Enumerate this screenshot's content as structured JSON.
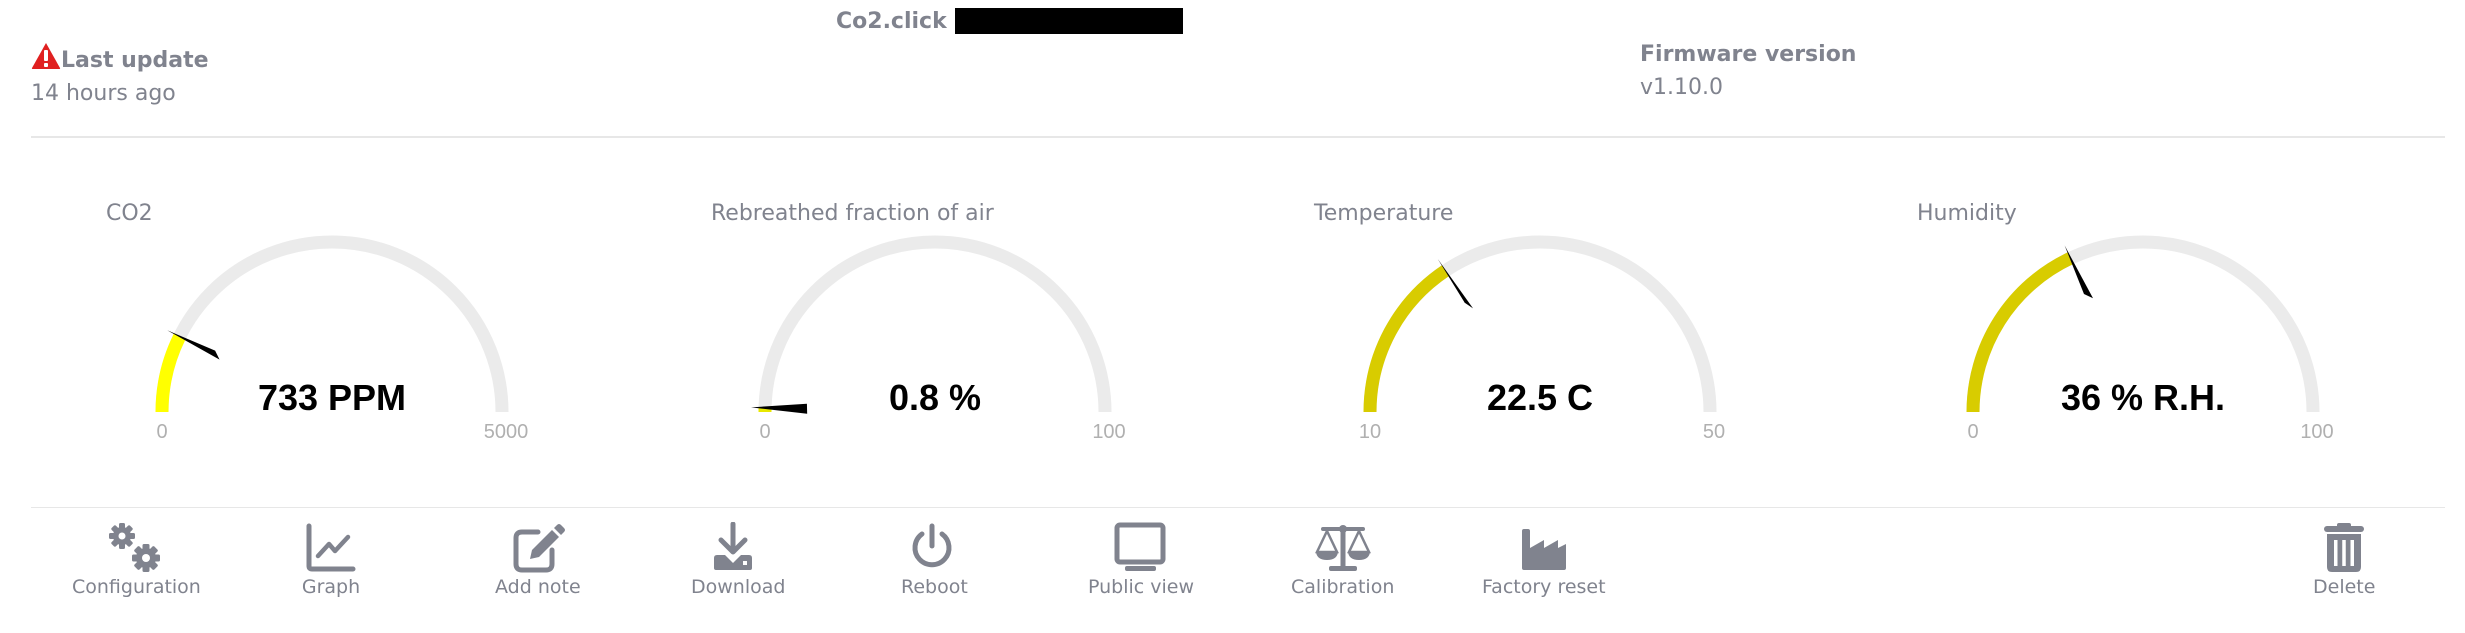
{
  "header": {
    "app_name": "Co2.click",
    "device_name_redacted": true,
    "last_update_label": "Last update",
    "last_update_value": "14 hours ago",
    "warning_icon": "warning-triangle-icon",
    "firmware_label": "Firmware version",
    "firmware_value": "v1.10.0"
  },
  "colors": {
    "text_gray": "#80838e",
    "track": "#ebebeb",
    "co2_fill": "#ffff00",
    "yellow_fill": "#d8cc00",
    "warning_red": "#e02020",
    "needle": "#000000"
  },
  "gauges": [
    {
      "title": "CO2",
      "value": 733,
      "min": 0,
      "max": 5000,
      "display": "733 PPM",
      "min_label": "0",
      "max_label": "5000",
      "fill_color": "#ffff00"
    },
    {
      "title": "Rebreathed fraction of air",
      "value": 0.8,
      "min": 0,
      "max": 100,
      "display": "0.8 %",
      "min_label": "0",
      "max_label": "100",
      "fill_color": "#e8e800"
    },
    {
      "title": "Temperature",
      "value": 22.5,
      "min": 10,
      "max": 50,
      "display": "22.5 C",
      "min_label": "10",
      "max_label": "50",
      "fill_color": "#d8cc00"
    },
    {
      "title": "Humidity",
      "value": 36,
      "min": 0,
      "max": 100,
      "display": "36 % R.H.",
      "min_label": "0",
      "max_label": "100",
      "fill_color": "#d8cc00"
    }
  ],
  "toolbar": [
    {
      "label": "Configuration",
      "icon": "gears-icon"
    },
    {
      "label": "Graph",
      "icon": "line-chart-icon"
    },
    {
      "label": "Add note",
      "icon": "edit-note-icon"
    },
    {
      "label": "Download",
      "icon": "download-icon"
    },
    {
      "label": "Reboot",
      "icon": "power-icon"
    },
    {
      "label": "Public view",
      "icon": "monitor-icon"
    },
    {
      "label": "Calibration",
      "icon": "balance-scale-icon"
    },
    {
      "label": "Factory reset",
      "icon": "factory-icon"
    },
    {
      "label": "Delete",
      "icon": "trash-icon"
    }
  ]
}
